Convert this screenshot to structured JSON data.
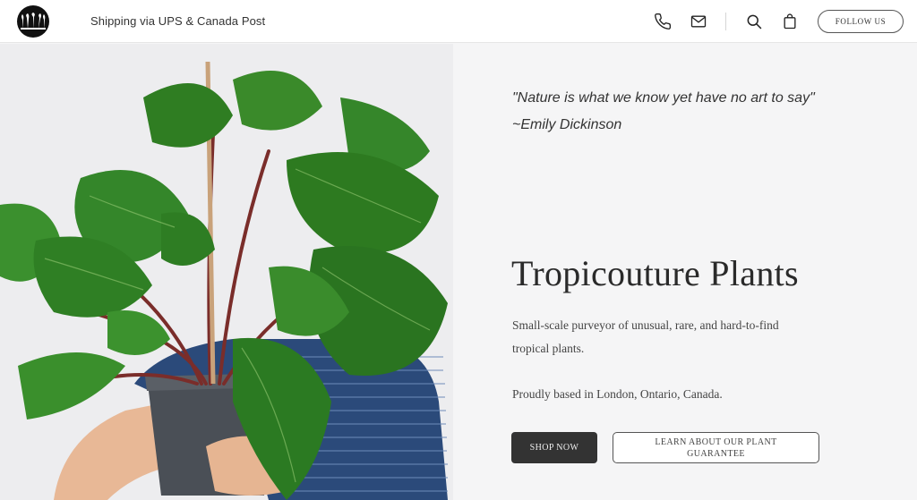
{
  "header": {
    "logo_name": "plant-logo",
    "shipping_text": "Shipping via UPS & Canada Post",
    "icons": [
      "phone-icon",
      "mail-icon",
      "search-icon",
      "shopping-bag-icon"
    ],
    "follow_label": "FOLLOW US"
  },
  "hero": {
    "quote_line1": "\"Nature is what we know yet have no art to say\"",
    "quote_line2": "~Emily Dickinson",
    "title": "Tropicouture Plants",
    "description": "Small-scale purveyor of unusual, rare, and hard-to-find tropical plants.",
    "location": "Proudly based in London, Ontario, Canada.",
    "shop_label": "SHOP NOW",
    "learn_label": "LEARN ABOUT OUR PLANT GUARANTEE"
  },
  "colors": {
    "background": "#f5f5f6",
    "header": "#ffffff",
    "dark_button": "#333333",
    "leaf_green": "#2f7d22"
  }
}
